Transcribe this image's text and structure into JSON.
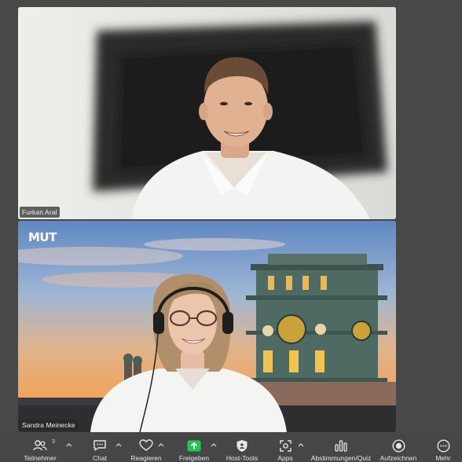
{
  "participants": [
    {
      "name": "Furkan Aral"
    },
    {
      "name": "Sandra Meinecke"
    }
  ],
  "background_logo": "MUT",
  "toolbar": {
    "participants_count": "3",
    "items": [
      {
        "label": "Teilnehmer",
        "icon": "participants-icon"
      },
      {
        "label": "Chat",
        "icon": "chat-icon"
      },
      {
        "label": "Reagieren",
        "icon": "heart-icon"
      },
      {
        "label": "Freigeben",
        "icon": "share-screen-icon"
      },
      {
        "label": "Host-Tools",
        "icon": "shield-icon"
      },
      {
        "label": "Apps",
        "icon": "apps-icon"
      },
      {
        "label": "Abstimmungen/Quiz",
        "icon": "poll-icon"
      },
      {
        "label": "Aufzeichnen",
        "icon": "record-icon"
      },
      {
        "label": "Mehr",
        "icon": "more-icon"
      }
    ]
  },
  "colors": {
    "background": "#484848",
    "share_green": "#23c552",
    "text": "#e6e6e6"
  }
}
